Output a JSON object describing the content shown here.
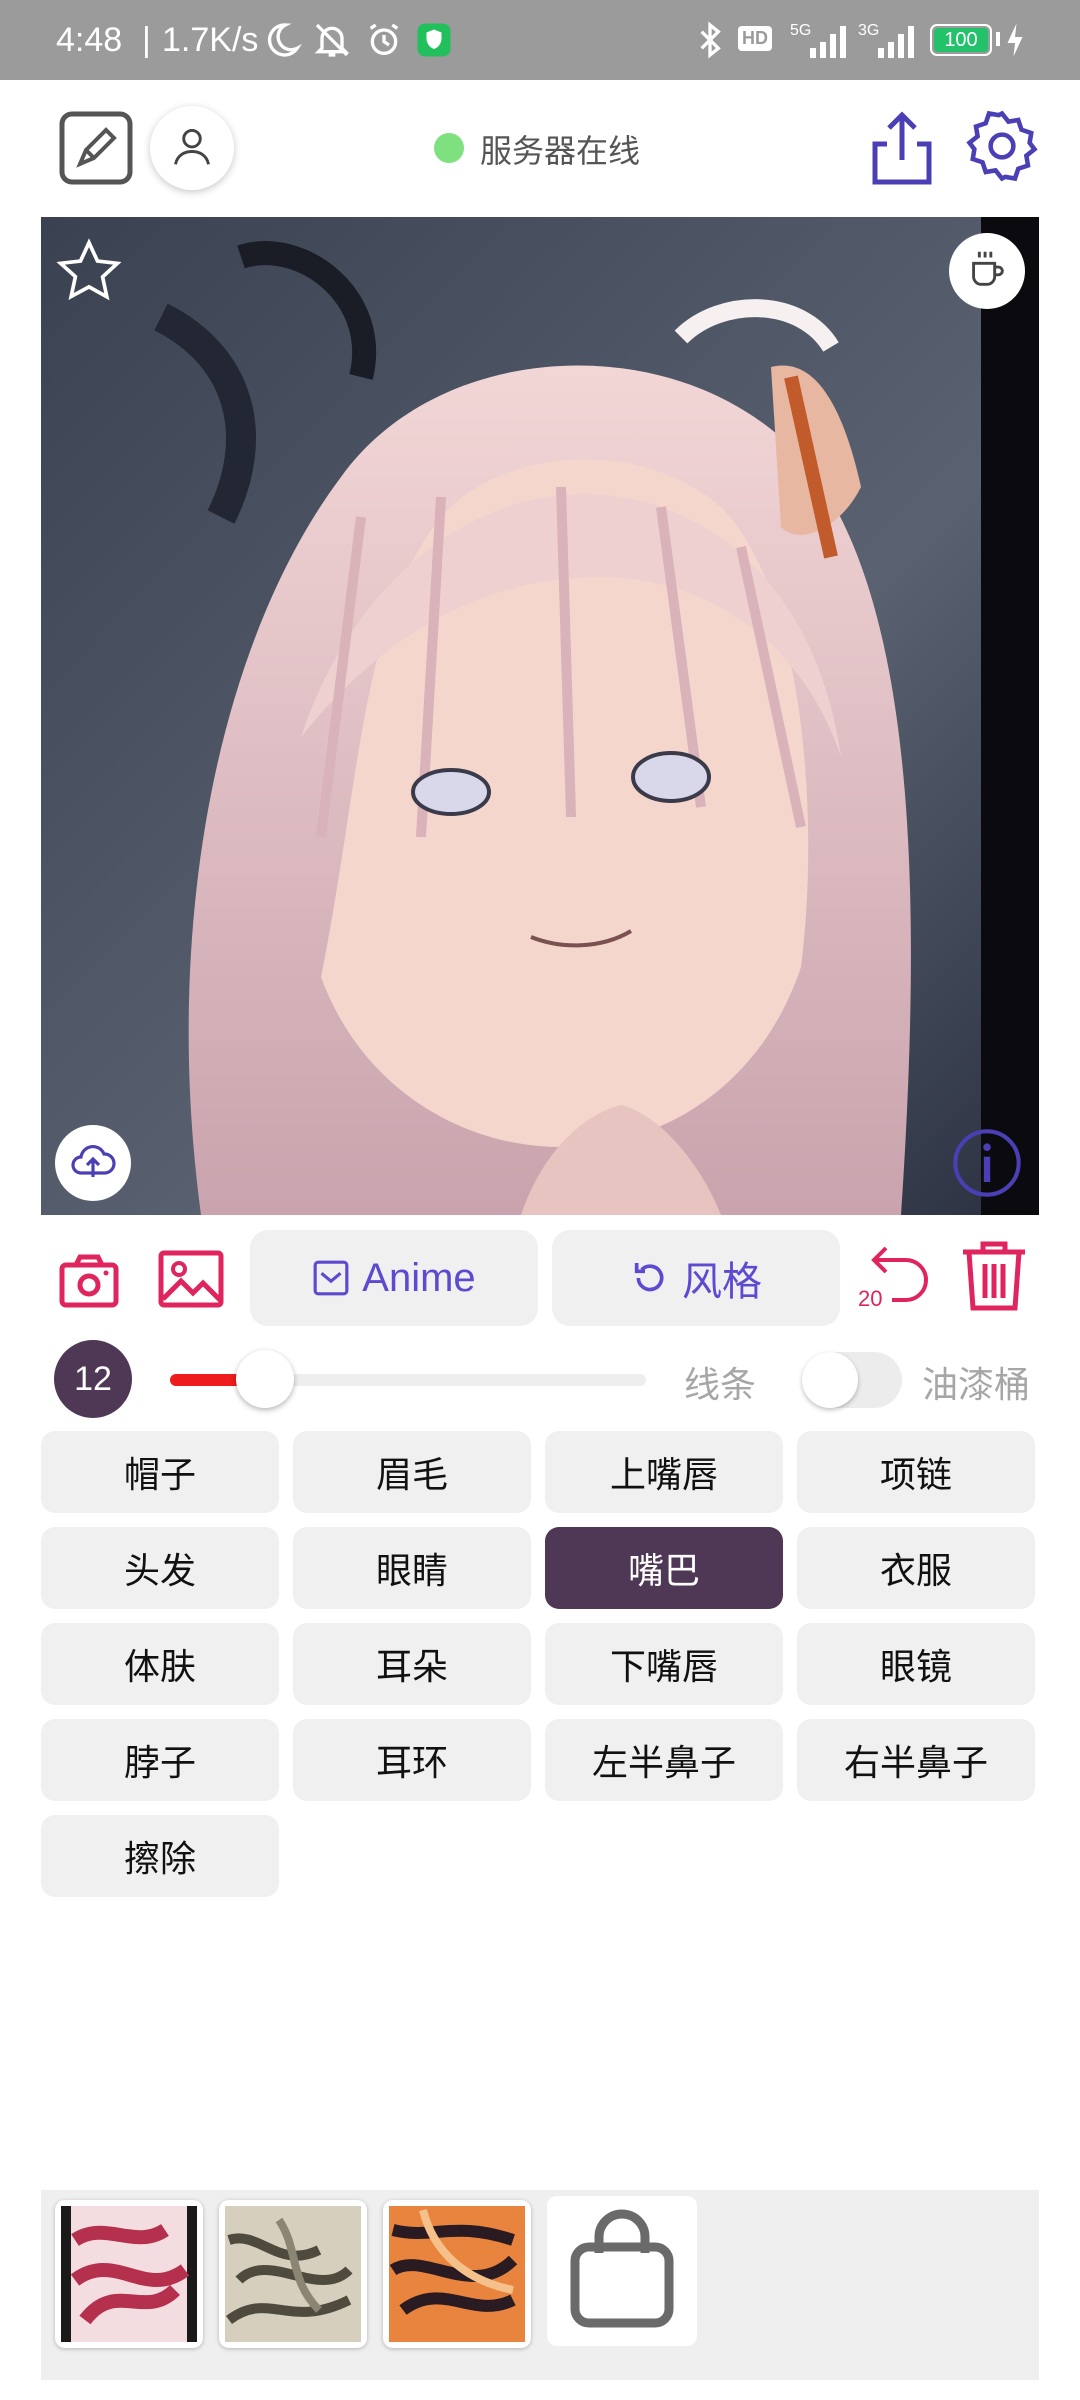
{
  "status_bar": {
    "time": "4:48",
    "net_speed": "1.7K/s",
    "network_5g": "5G",
    "network_3g": "3G",
    "hd": "HD",
    "battery": "100",
    "icons": [
      "moon-icon",
      "bell-off-icon",
      "alarm-icon",
      "shield-app-icon",
      "bluetooth-icon",
      "signal-icon",
      "battery-icon",
      "charging-icon"
    ]
  },
  "toolbar": {
    "server_status": "服务器在线",
    "server_status_color": "#7fe07f",
    "icons": [
      "edit-icon",
      "user-icon",
      "share-icon",
      "settings-icon"
    ]
  },
  "canvas": {
    "icons": [
      "star-icon",
      "coffee-icon",
      "upload-cloud-icon",
      "info-icon"
    ]
  },
  "actions": {
    "anime_label": "Anime",
    "style_label": "风格",
    "undo_count": "20",
    "accent_color": "#e0245e",
    "icons": [
      "camera-icon",
      "image-icon",
      "checkbox-icon",
      "refresh-icon",
      "undo-icon",
      "trash-icon"
    ]
  },
  "brush": {
    "size": "12",
    "slider_fraction": 0.2,
    "line_label": "线条",
    "bucket_label": "油漆桶",
    "bucket_enabled": false
  },
  "labels": {
    "selected": "嘴巴",
    "items": [
      "帽子",
      "眉毛",
      "上嘴唇",
      "项链",
      "头发",
      "眼睛",
      "嘴巴",
      "衣服",
      "体肤",
      "耳朵",
      "下嘴唇",
      "眼镜",
      "脖子",
      "耳环",
      "左半鼻子",
      "右半鼻子",
      "擦除"
    ]
  },
  "gallery": {
    "thumbnails": [
      "thumbnail-1",
      "thumbnail-2",
      "thumbnail-3"
    ],
    "icons": [
      "bag-icon"
    ]
  }
}
